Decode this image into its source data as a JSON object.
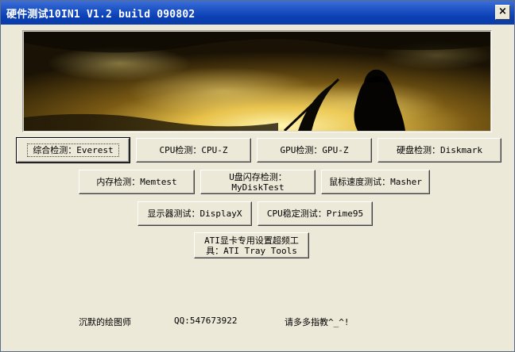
{
  "window": {
    "title": "硬件测试10IN1 V1.2 build 090802",
    "close_label": "×"
  },
  "buttons": {
    "everest": "综合检测：Everest",
    "cpuz": "CPU检测：CPU-Z",
    "gpuz": "GPU检测：GPU-Z",
    "diskmark": "硬盘检测：Diskmark",
    "memtest": "内存检测：Memtest",
    "mydisktest_l1": "U盘闪存检测：",
    "mydisktest_l2": "MyDiskTest",
    "masher": "鼠标速度测试：Masher",
    "displayx": "显示器测试：DisplayX",
    "prime95": "CPU稳定测试：Prime95",
    "ati_l1": "ATI显卡专用设置超频工",
    "ati_l2": "具：ATI Tray Tools"
  },
  "footer": {
    "author": "沉默的绘图师",
    "qq": "QQ:547673922",
    "note": "请多多指教^_^!"
  }
}
